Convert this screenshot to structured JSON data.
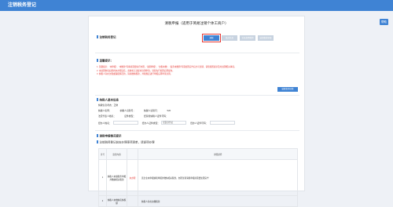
{
  "header": {
    "title": "注销税务登记"
  },
  "help_label": "帮助",
  "page_title": "清税申报（适用于简易注销个体工商户）",
  "sections": {
    "s1": "注销税务登记",
    "s2": "温馨提示：",
    "s3": "纳税人基本信息",
    "s4": "清税申报情况提示",
    "s5": "注销税务登记前应办理事项清单，请逐项办理"
  },
  "steps": [
    "清税",
    "核对信息",
    "补录发票缴销",
    "结清税款申报"
  ],
  "notice": [
    "1. 温馨提示：“未申报”、“未缴款”等事项需要先行办理，“逾期申报”、“欠税未缴”、“发票未缴销”等需处理完毕后方可注销，请您按照提示及时处理相关事项。",
    "2. 未处理事项如果尚未办理完结，系统将无法提交注销申请，请您先行处理后再提交。",
    "3. 纳税人存在欠税或漏报情况的，请先缴纳税款，并按规定进行申报后再申请注销。"
  ],
  "notice_button": "结果查询功能",
  "info": {
    "line1": "纳税信息状态：正常",
    "taxpayer_name_label": "纳税人名称：",
    "taxpayer_name": "",
    "credit_code_label": "纳税人识别号：",
    "credit_code": "",
    "id_label": "纳税人识别号：",
    "id_value": "520",
    "legal_label": "法定代表人姓名：",
    "legal_value": "",
    "cert_type_label": "证件类型：",
    "cert_no_label": "经营者纳税人证件号码：",
    "register_label": "纳税人登记地：",
    "register_value": "",
    "agent_label": "经办人姓名：",
    "agent_value": "",
    "agent_cert_label": "经办人证件类型：",
    "agent_cert_value": "居民身份证",
    "agent_no_label": "经办人证件号码："
  },
  "table": {
    "headers": [
      "序号",
      "监控内容",
      "",
      "详细说明"
    ],
    "rows": [
      {
        "no": "1",
        "content": "纳税人未做税务申报并缴纳相关税款",
        "status": "未办理",
        "detail": "该企业未申报纳税申报并缴纳相关税款，办理注销清税申报前需要处理完毕"
      },
      {
        "no": "2",
        "content": "纳税人未缴纳应纳税额",
        "status": "",
        "detail": "纳税人存在欠缴税款"
      }
    ]
  }
}
